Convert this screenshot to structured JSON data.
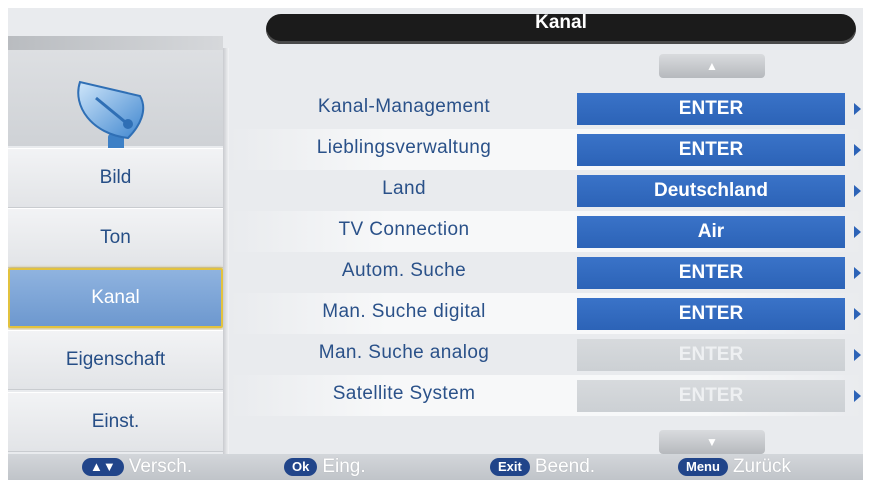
{
  "header": {
    "title": "Kanal"
  },
  "sidebar": {
    "icon": "satellite-dish-icon",
    "items": [
      {
        "label": "Bild",
        "active": false
      },
      {
        "label": "Ton",
        "active": false
      },
      {
        "label": "Kanal",
        "active": true
      },
      {
        "label": "Eigenschaft",
        "active": false
      },
      {
        "label": "Einst.",
        "active": false
      }
    ]
  },
  "scroll": {
    "up": "▲",
    "down": "▼"
  },
  "menu": {
    "rows": [
      {
        "label": "Kanal-Management",
        "value": "ENTER",
        "enabled": true
      },
      {
        "label": "Lieblingsverwaltung",
        "value": "ENTER",
        "enabled": true
      },
      {
        "label": "Land",
        "value": "Deutschland",
        "enabled": true
      },
      {
        "label": "TV Connection",
        "value": "Air",
        "enabled": true
      },
      {
        "label": "Autom. Suche",
        "value": "ENTER",
        "enabled": true
      },
      {
        "label": "Man. Suche digital",
        "value": "ENTER",
        "enabled": true
      },
      {
        "label": "Man. Suche analog",
        "value": "ENTER",
        "enabled": false
      },
      {
        "label": "Satellite System",
        "value": "ENTER",
        "enabled": false
      }
    ]
  },
  "footer": {
    "hints": [
      {
        "key": "▲▼",
        "text": "Versch."
      },
      {
        "key": "Ok",
        "text": "Eing."
      },
      {
        "key": "Exit",
        "text": "Beend."
      },
      {
        "key": "Menu",
        "text": "Zurück"
      }
    ]
  },
  "colors": {
    "accent": "#2c63b7",
    "label_text": "#2a5189",
    "active_border": "#e2c23e",
    "title_bar": "#1b1b1b"
  }
}
